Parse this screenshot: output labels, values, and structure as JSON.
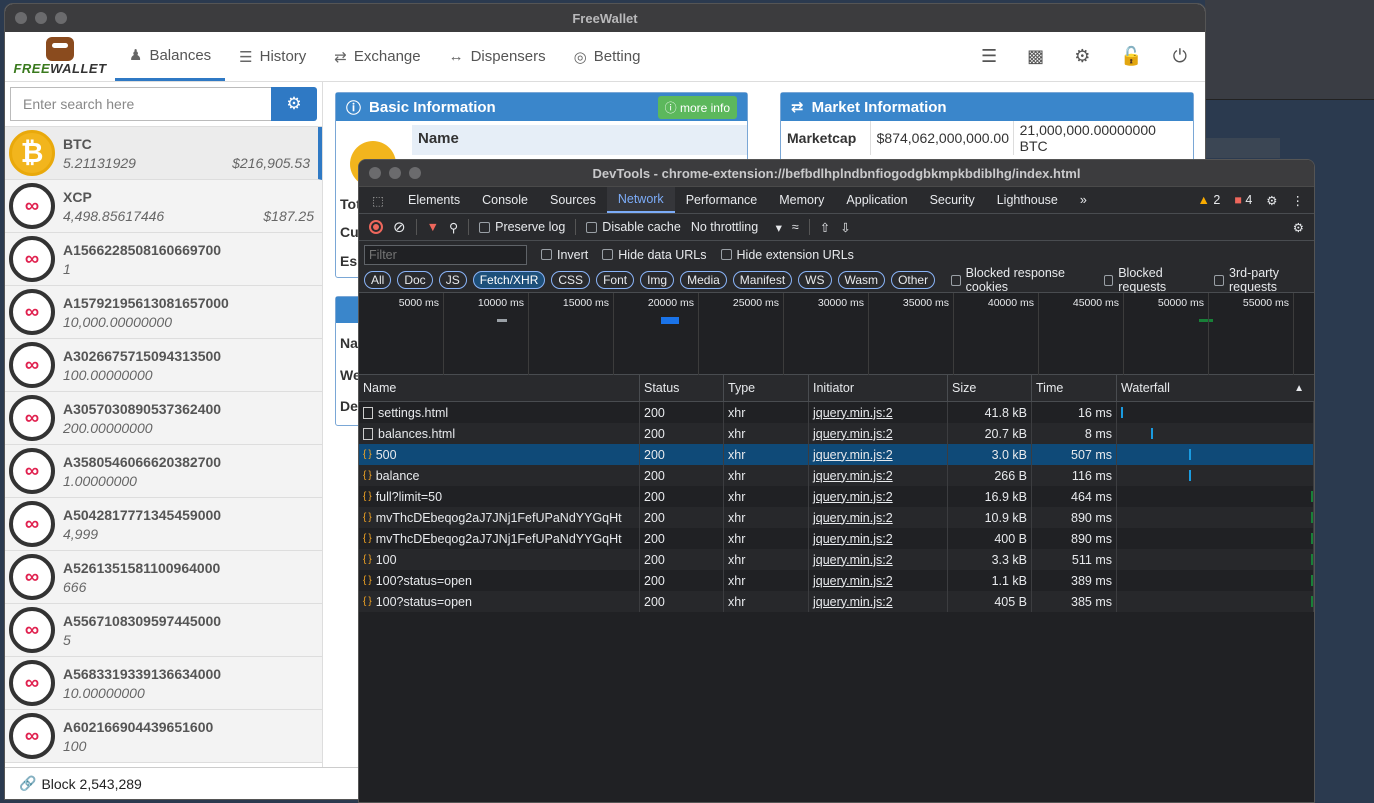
{
  "freewallet": {
    "title": "FreeWallet",
    "logo_text_a": "FREE",
    "logo_text_b": "WALLET",
    "nav": [
      {
        "label": "Balances",
        "icon": "user-icon"
      },
      {
        "label": "History",
        "icon": "list-icon"
      },
      {
        "label": "Exchange",
        "icon": "exchange-icon"
      },
      {
        "label": "Dispensers",
        "icon": "arrows-horizontal-icon"
      },
      {
        "label": "Betting",
        "icon": "target-icon"
      }
    ],
    "search_placeholder": "Enter search here",
    "assets": [
      {
        "name": "BTC",
        "amount": "5.21131929",
        "value": "$216,905.53",
        "type": "btc"
      },
      {
        "name": "XCP",
        "amount": "4,498.85617446",
        "value": "$187.25",
        "type": "xcp"
      },
      {
        "name": "A15662285081606697​00",
        "amount": "1",
        "value": "",
        "type": "xcp"
      },
      {
        "name": "A1579219561308165700​0",
        "amount": "10,000.00000000",
        "value": "",
        "type": "xcp"
      },
      {
        "name": "A302667571509431350​0",
        "amount": "100.00000000",
        "value": "",
        "type": "xcp"
      },
      {
        "name": "A3057030890537362400",
        "amount": "200.00000000",
        "value": "",
        "type": "xcp"
      },
      {
        "name": "A3580546066620382700",
        "amount": "1.00000000",
        "value": "",
        "type": "xcp"
      },
      {
        "name": "A5042817771345459000",
        "amount": "4,999",
        "value": "",
        "type": "xcp"
      },
      {
        "name": "A5261351581100964000",
        "amount": "666",
        "value": "",
        "type": "xcp"
      },
      {
        "name": "A5567108309597445000",
        "amount": "5",
        "value": "",
        "type": "xcp"
      },
      {
        "name": "A5683319339136634000",
        "amount": "10.00000000",
        "value": "",
        "type": "xcp"
      },
      {
        "name": "A602166904439651600",
        "amount": "100",
        "value": "",
        "type": "xcp"
      }
    ],
    "block": "Block 2,543,289",
    "basic_info": {
      "title": "Basic Information",
      "more": "more info",
      "name_col": "Name",
      "rows": [
        "Tot",
        "Cu",
        "Es"
      ]
    },
    "small_panel_rows": [
      "Na",
      "We",
      "De"
    ],
    "market": {
      "title": "Market Information",
      "label": "Marketcap",
      "value": "$874,062,000,000.00",
      "supply": "21,000,000.00000000 BTC"
    }
  },
  "devtools": {
    "title": "DevTools - chrome-extension://befbdlhplndbnfiogodgbkmpkbdiblhg/index.html",
    "tabs": [
      "Elements",
      "Console",
      "Sources",
      "Network",
      "Performance",
      "Memory",
      "Application",
      "Security",
      "Lighthouse"
    ],
    "active_tab": "Network",
    "warnings": "2",
    "errors": "4",
    "toolbar": {
      "preserve_log": "Preserve log",
      "disable_cache": "Disable cache",
      "throttling": "No throttling"
    },
    "filter": {
      "placeholder": "Filter",
      "invert": "Invert",
      "hide_data": "Hide data URLs",
      "hide_ext": "Hide extension URLs"
    },
    "types": [
      "All",
      "Doc",
      "JS",
      "Fetch/XHR",
      "CSS",
      "Font",
      "Img",
      "Media",
      "Manifest",
      "WS",
      "Wasm",
      "Other"
    ],
    "active_type": "Fetch/XHR",
    "type_checks": [
      "Blocked response cookies",
      "Blocked requests",
      "3rd-party requests"
    ],
    "overview_ticks": [
      "5000 ms",
      "10000 ms",
      "15000 ms",
      "20000 ms",
      "25000 ms",
      "30000 ms",
      "35000 ms",
      "40000 ms",
      "45000 ms",
      "50000 ms",
      "55000 ms"
    ],
    "columns": [
      "Name",
      "Status",
      "Type",
      "Initiator",
      "Size",
      "Time",
      "Waterfall"
    ],
    "requests": [
      {
        "name": "settings.html",
        "status": "200",
        "type": "xhr",
        "initiator": "jquery.min.js:2",
        "size": "41.8 kB",
        "time": "16 ms",
        "icon": "doc"
      },
      {
        "name": "balances.html",
        "status": "200",
        "type": "xhr",
        "initiator": "jquery.min.js:2",
        "size": "20.7 kB",
        "time": "8 ms",
        "icon": "doc"
      },
      {
        "name": "500",
        "status": "200",
        "type": "xhr",
        "initiator": "jquery.min.js:2",
        "size": "3.0 kB",
        "time": "507 ms",
        "icon": "xhr",
        "selected": true
      },
      {
        "name": "balance",
        "status": "200",
        "type": "xhr",
        "initiator": "jquery.min.js:2",
        "size": "266 B",
        "time": "116 ms",
        "icon": "xhr"
      },
      {
        "name": "full?limit=50",
        "status": "200",
        "type": "xhr",
        "initiator": "jquery.min.js:2",
        "size": "16.9 kB",
        "time": "464 ms",
        "icon": "xhr"
      },
      {
        "name": "mvThcDEbeqog2aJ7JNj1FefUPaNdYYGqHt",
        "status": "200",
        "type": "xhr",
        "initiator": "jquery.min.js:2",
        "size": "10.9 kB",
        "time": "890 ms",
        "icon": "xhr"
      },
      {
        "name": "mvThcDEbeqog2aJ7JNj1FefUPaNdYYGqHt",
        "status": "200",
        "type": "xhr",
        "initiator": "jquery.min.js:2",
        "size": "400 B",
        "time": "890 ms",
        "icon": "xhr"
      },
      {
        "name": "100",
        "status": "200",
        "type": "xhr",
        "initiator": "jquery.min.js:2",
        "size": "3.3 kB",
        "time": "511 ms",
        "icon": "xhr"
      },
      {
        "name": "100?status=open",
        "status": "200",
        "type": "xhr",
        "initiator": "jquery.min.js:2",
        "size": "1.1 kB",
        "time": "389 ms",
        "icon": "xhr"
      },
      {
        "name": "100?status=open",
        "status": "200",
        "type": "xhr",
        "initiator": "jquery.min.js:2",
        "size": "405 B",
        "time": "385 ms",
        "icon": "xhr"
      }
    ]
  }
}
